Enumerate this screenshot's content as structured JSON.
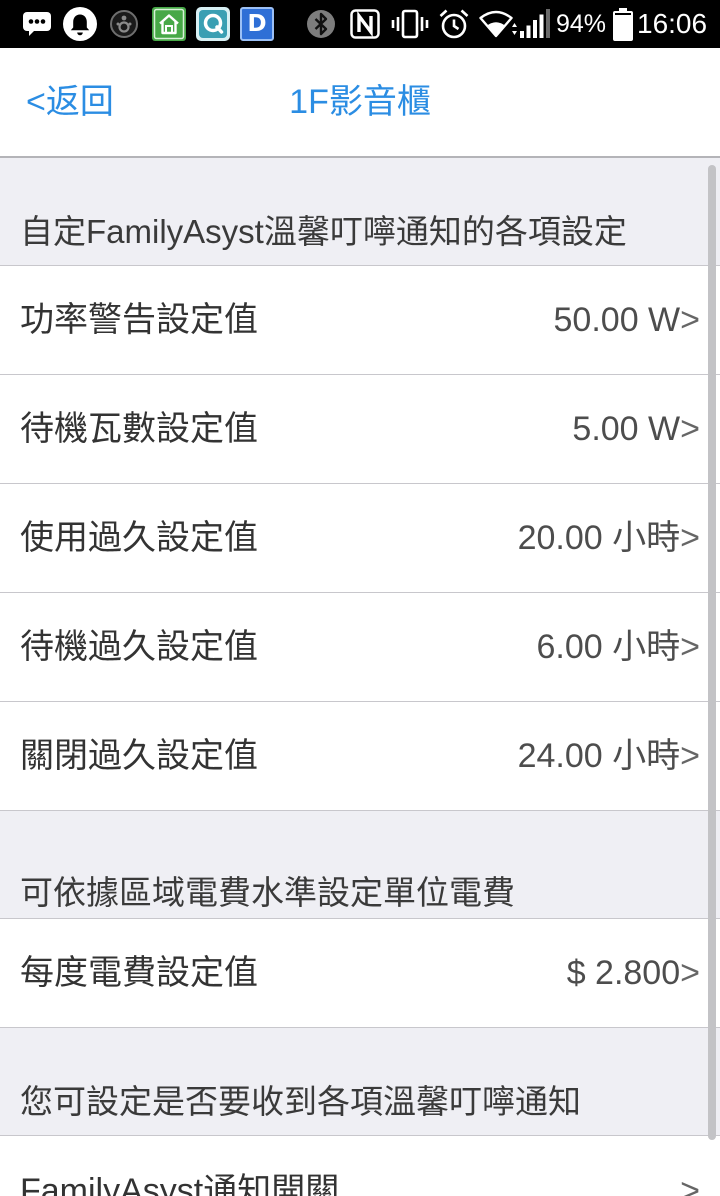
{
  "theme": {
    "accent": "#2b8de3",
    "status_bar_bg": "#000000",
    "page_bg": "#efeff4",
    "row_bg": "#ffffff",
    "separator": "#c8c7cc"
  },
  "status_bar": {
    "left_icons": [
      "message-icon",
      "notification-bell-icon",
      "circle-dots-icon",
      "home-app-icon",
      "q-app-icon",
      "d-app-icon"
    ],
    "d_app_letter": "D",
    "right_icons": [
      "bluetooth-icon",
      "nfc-icon",
      "vibrate-icon",
      "alarm-icon",
      "wifi-icon",
      "signal-icon",
      "battery-icon"
    ],
    "battery_text": "94%",
    "battery_level": 0.94,
    "time": "16:06"
  },
  "nav": {
    "back_label": "<返回",
    "title": "1F影音櫃"
  },
  "chevron": ">",
  "sections": [
    {
      "header": "自定FamilyAsyst溫馨叮嚀通知的各項設定",
      "rows": [
        {
          "label": "功率警告設定值",
          "value": "50.00 W"
        },
        {
          "label": "待機瓦數設定值",
          "value": "5.00 W"
        },
        {
          "label": "使用過久設定值",
          "value": "20.00 小時"
        },
        {
          "label": "待機過久設定值",
          "value": "6.00 小時"
        },
        {
          "label": "關閉過久設定值",
          "value": "24.00 小時"
        }
      ]
    },
    {
      "header": "可依據區域電費水準設定單位電費",
      "rows": [
        {
          "label": "每度電費設定值",
          "value": "$ 2.800"
        }
      ]
    },
    {
      "header": "您可設定是否要收到各項溫馨叮嚀通知",
      "rows": [
        {
          "label": "FamilyAsyst通知開關"
        }
      ]
    }
  ]
}
